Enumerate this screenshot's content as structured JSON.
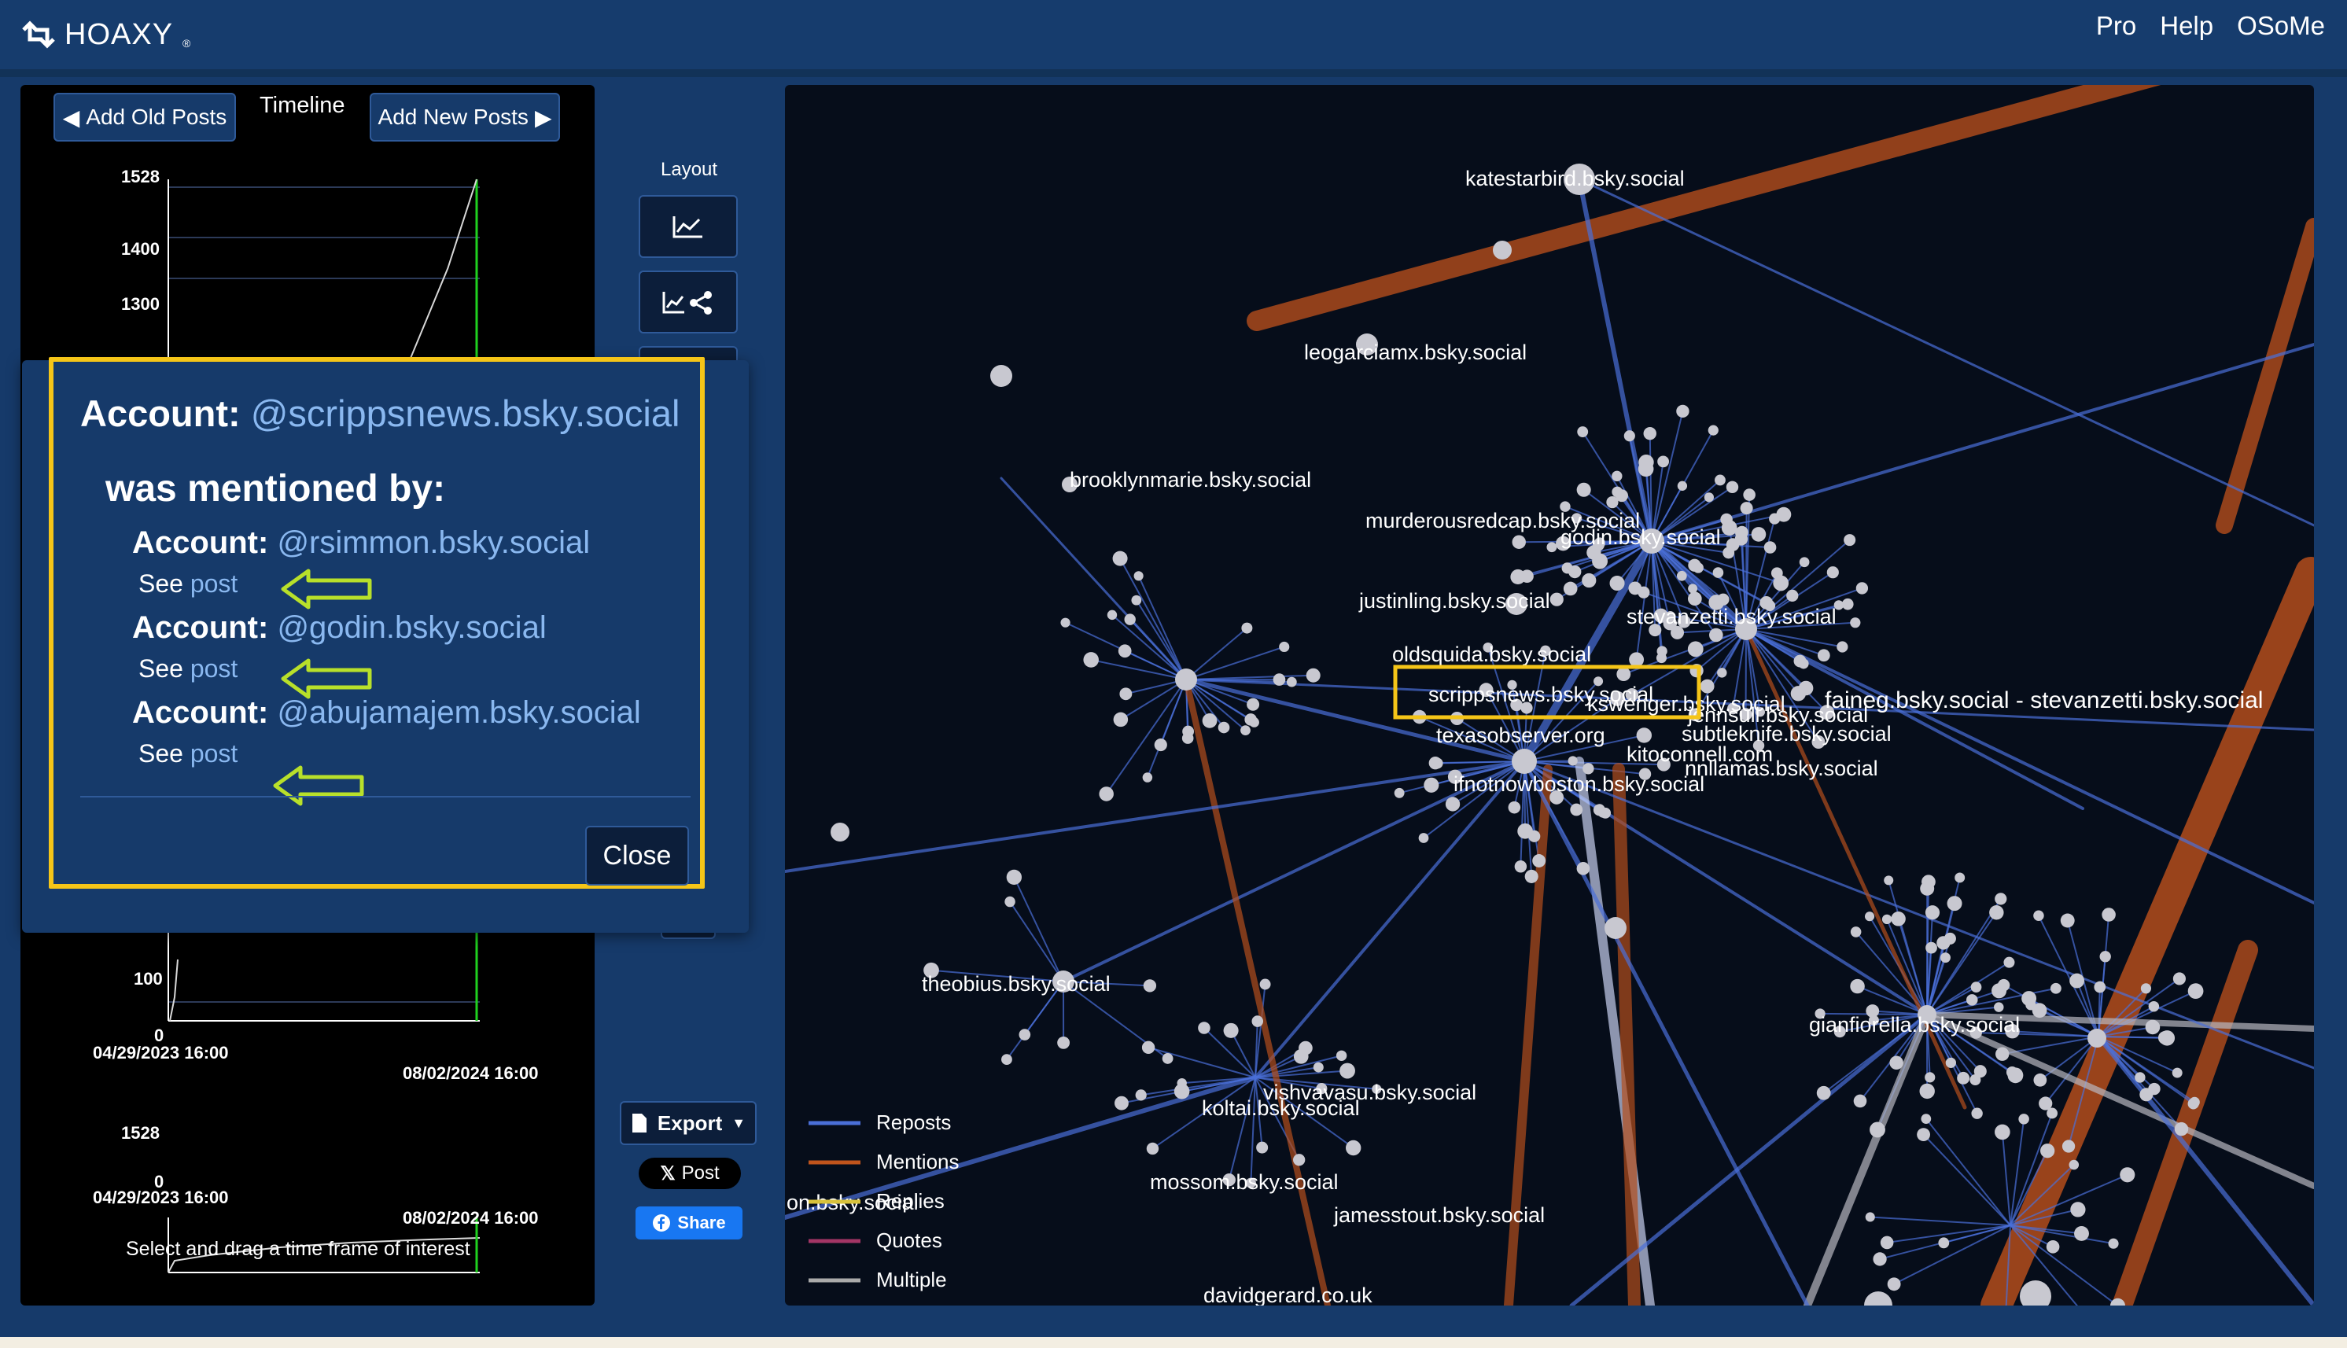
{
  "header": {
    "brand": "HOAXY",
    "brand_mark": "®",
    "nav": [
      "Pro",
      "Help",
      "OSoMe"
    ]
  },
  "timeline": {
    "add_old_label": "Add Old Posts",
    "title": "Timeline",
    "add_new_label": "Add New Posts",
    "main_chart": {
      "y_labels": [
        "1528",
        "1400",
        "1300",
        "100",
        "0"
      ],
      "x_start": "04/29/2023 16:00",
      "x_end": "08/02/2024 16:00"
    },
    "mini_chart": {
      "y_labels": [
        "1528",
        "0"
      ],
      "x_start": "04/29/2023 16:00",
      "x_end": "08/02/2024 16:00"
    },
    "hint": "Select and drag a time frame of interest"
  },
  "chart_data": [
    {
      "type": "line",
      "title": "",
      "xlabel": "",
      "ylabel": "",
      "x": [
        "04/29/2023 16:00",
        "08/02/2024 16:00"
      ],
      "ylim": [
        0,
        1528
      ],
      "series": [
        {
          "values": [
            0,
            60,
            100,
            300,
            900,
            1200,
            1300,
            1400,
            1528
          ]
        }
      ]
    }
  ],
  "toolbar": {
    "layout_label": "Layout",
    "export_label": "Export",
    "xpost_label": "Post",
    "share_label": "Share"
  },
  "popup": {
    "account_prefix": "Account:",
    "account_handle": "@scrippsnews.bsky.social",
    "subheading": "was mentioned by:",
    "mentions": [
      {
        "prefix": "Account:",
        "handle": "@rsimmon.bsky.social",
        "see": "See",
        "link": "post"
      },
      {
        "prefix": "Account:",
        "handle": "@godin.bsky.social",
        "see": "See",
        "link": "post"
      },
      {
        "prefix": "Account:",
        "handle": "@abujamajem.bsky.social",
        "see": "See",
        "link": "post"
      }
    ],
    "close_label": "Close"
  },
  "network": {
    "labels": [
      "katestarbird.bsky.social",
      "leogarciamx.bsky.social",
      "brooklynmarie.bsky.social",
      "murderousredcap.bsky.social",
      "godin.bsky.social",
      "justinling.bsky.social",
      "stevanzetti.bsky.social",
      "oldsquida.bsky.social",
      "scrippsnews.bsky.social",
      "kswenger.bsky.social",
      "jennsull.bsky.social",
      "faineg.bsky.social - stevanzetti.bsky.social",
      "texasobserver.org",
      "subtleknife.bsky.social",
      "kitoconnell.com",
      "nnllamas.bsky.social",
      "ifnotnowboston.bsky.social",
      "theobius.bsky.social",
      "gianfiorella.bsky.social",
      "vishvavasu.bsky.social",
      "koltai.bsky.social",
      "mossom.bsky.social",
      "jamesstout.bsky.social",
      "davidgerard.co.uk",
      "on.bsky.social"
    ],
    "legend": [
      "Reposts",
      "Mentions",
      "Replies",
      "Quotes",
      "Multiple"
    ],
    "legend_colors": [
      "#4a6fd8",
      "#c0541c",
      "#d8c23c",
      "#a33565",
      "#aaaaaa"
    ]
  }
}
